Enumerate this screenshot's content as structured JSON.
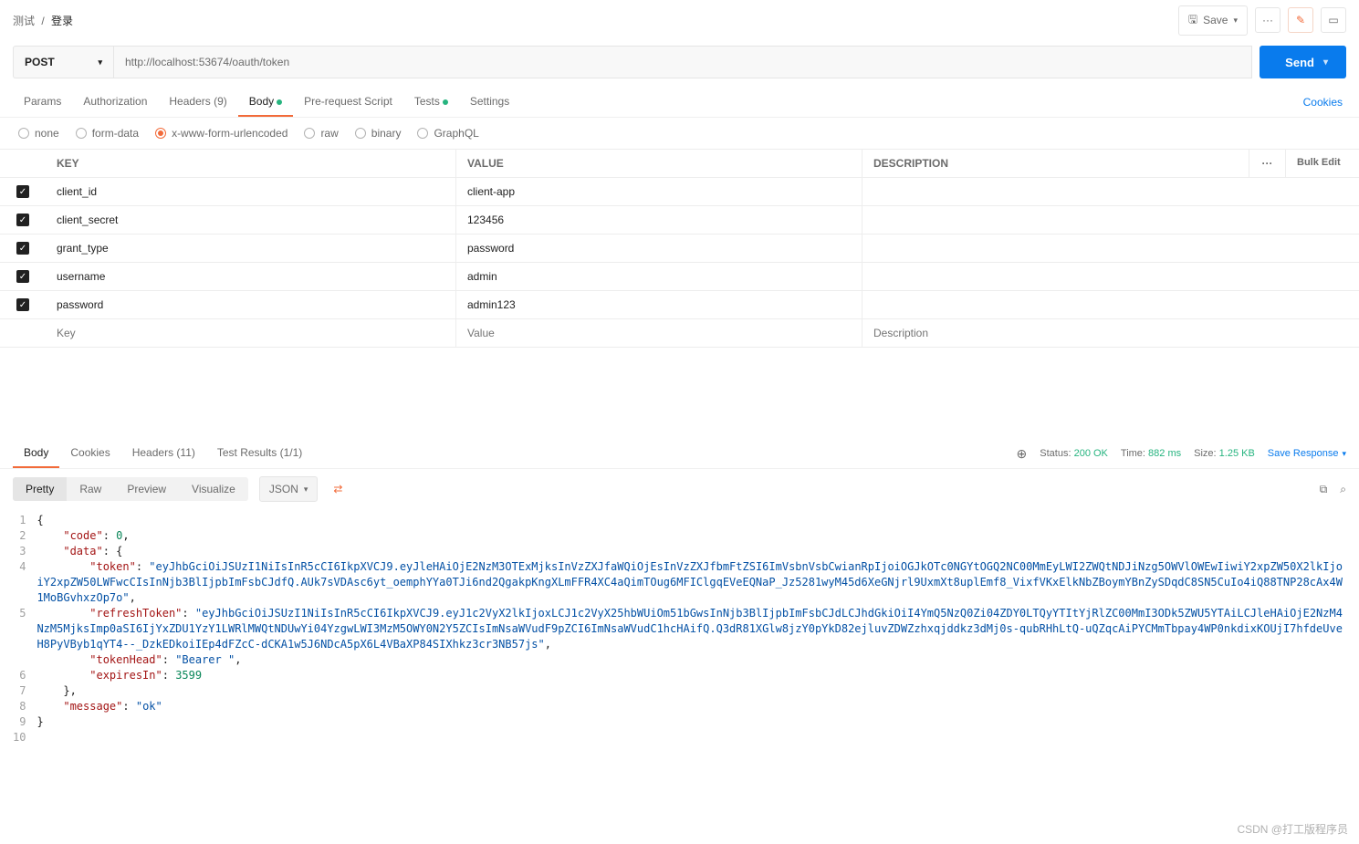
{
  "breadcrumb": {
    "root": "测试",
    "current": "登录"
  },
  "top": {
    "save": "Save",
    "more": "···"
  },
  "request": {
    "method": "POST",
    "url": "http://localhost:53674/oauth/token",
    "send": "Send"
  },
  "tabs": {
    "params": "Params",
    "auth": "Authorization",
    "headers": "Headers",
    "headers_count": "(9)",
    "body": "Body",
    "prereq": "Pre-request Script",
    "tests": "Tests",
    "settings": "Settings",
    "cookies": "Cookies"
  },
  "body_types": {
    "none": "none",
    "formdata": "form-data",
    "urlencoded": "x-www-form-urlencoded",
    "raw": "raw",
    "binary": "binary",
    "graphql": "GraphQL"
  },
  "table": {
    "head_key": "KEY",
    "head_value": "VALUE",
    "head_desc": "DESCRIPTION",
    "bulk": "Bulk Edit",
    "more": "···",
    "rows": [
      {
        "key": "client_id",
        "value": "client-app"
      },
      {
        "key": "client_secret",
        "value": "123456"
      },
      {
        "key": "grant_type",
        "value": "password"
      },
      {
        "key": "username",
        "value": "admin"
      },
      {
        "key": "password",
        "value": "admin123"
      }
    ],
    "ph_key": "Key",
    "ph_value": "Value",
    "ph_desc": "Description"
  },
  "response": {
    "tabs": {
      "body": "Body",
      "cookies": "Cookies",
      "headers": "Headers",
      "headers_count": "(11)",
      "tests": "Test Results",
      "tests_count": "(1/1)"
    },
    "status_label": "Status:",
    "status_value": "200 OK",
    "time_label": "Time:",
    "time_value": "882 ms",
    "size_label": "Size:",
    "size_value": "1.25 KB",
    "save": "Save Response"
  },
  "view": {
    "pretty": "Pretty",
    "raw": "Raw",
    "preview": "Preview",
    "visualize": "Visualize",
    "format": "JSON"
  },
  "json_body": {
    "line1": "{",
    "code_key": "\"code\"",
    "code_val": "0",
    "data_key": "\"data\"",
    "token_key": "\"token\"",
    "token_val": "\"eyJhbGciOiJSUzI1NiIsInR5cCI6IkpXVCJ9.eyJleHAiOjE2NzM3OTExMjksInVzZXJfaWQiOjEsInVzZXJfbmFtZSI6ImVsbnVsbCwianRpIjoiOGJkOTc0NGYtOGQ2NC00MmEyLWI2ZWQtNDJiNzg5OWVlOWEwIiwiY2xpZW50X2lkIjoiY2xpZW50LWFwcCIsInNjb3BlIjpbImFsbCJdfQ.AUk7sVDAsc6yt_oemphYYa0TJi6nd2QgakpKngXLmFFR4XC4aQimTOug6MFIClgqEVeEQNaP_Jz5281wyM45d6XeGNjrl9UxmXt8uplEmf8_VixfVKxElkNbZBoymYBnZySDqdC8SN5CuIo4iQ88TNP28cAx4W1MoBGvhxzOp7o\"",
    "refresh_key": "\"refreshToken\"",
    "refresh_val": "\"eyJhbGciOiJSUzI1NiIsInR5cCI6IkpXVCJ9.eyJ1c2VyX2lkIjoxLCJ1c2VyX25hbWUiOm51bGwsInNjb3BlIjpbImFsbCJdLCJhdGkiOiI4YmQ5NzQ0Zi04ZDY0LTQyYTItYjRlZC00MmI3ODk5ZWU5YTAiLCJleHAiOjE2NzM4NzM5MjksImp0aSI6IjYxZDU1YzY1LWRlMWQtNDUwYi04YzgwLWI3MzM5OWY0N2Y5ZCIsImNsaWVudF9pZCI6ImNsaWVudC1hcHAifQ.Q3dR81XGlw8jzY0pYkD82ejluvZDWZzhxqjddkz3dMj0s-qubRHhLtQ-uQZqcAiPYCMmTbpay4WP0nkdixKOUjI7hfdeUveH8PyVByb1qYT4--_DzkEDkoiIEp4dFZcC-dCKA1w5J6NDcA5pX6L4VBaXP84SIXhkz3cr3NB57js\"",
    "tokenhead_key": "\"tokenHead\"",
    "tokenhead_val": "\"Bearer \"",
    "expires_key": "\"expiresIn\"",
    "expires_val": "3599",
    "msg_key": "\"message\"",
    "msg_val": "\"ok\""
  },
  "watermark": "CSDN @打工版程序员"
}
